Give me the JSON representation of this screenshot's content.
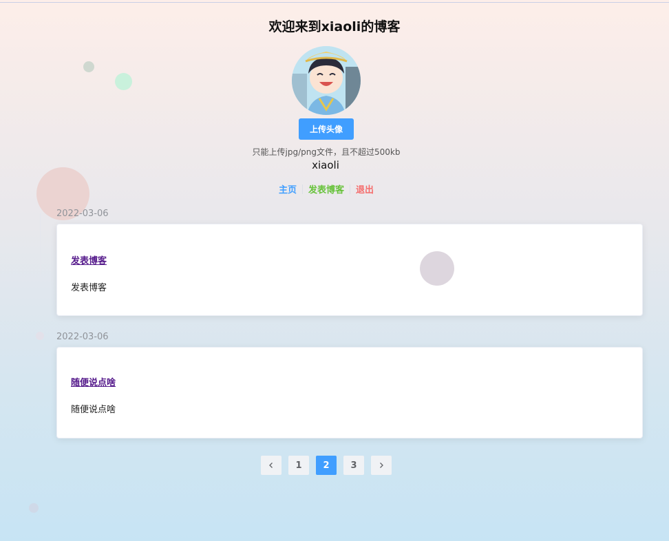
{
  "header": {
    "title": "欢迎来到xiaoli的博客",
    "upload_button": "上传头像",
    "upload_tip": "只能上传jpg/png文件，且不超过500kb",
    "username": "xiaoli"
  },
  "nav": {
    "home": "主页",
    "post": "发表博客",
    "logout": "退出"
  },
  "posts": [
    {
      "date": "2022-03-06",
      "title": "发表博客",
      "content": "发表博客"
    },
    {
      "date": "2022-03-06",
      "title": "随便说点啥",
      "content": "随便说点啥"
    }
  ],
  "pagination": {
    "prev_icon": "chevron-left-icon",
    "next_icon": "chevron-right-icon",
    "pages": [
      "1",
      "2",
      "3"
    ],
    "current": "2"
  },
  "colors": {
    "primary": "#409eff",
    "success": "#67c23a",
    "danger": "#f56c6c",
    "link_visited": "#551a8b"
  }
}
